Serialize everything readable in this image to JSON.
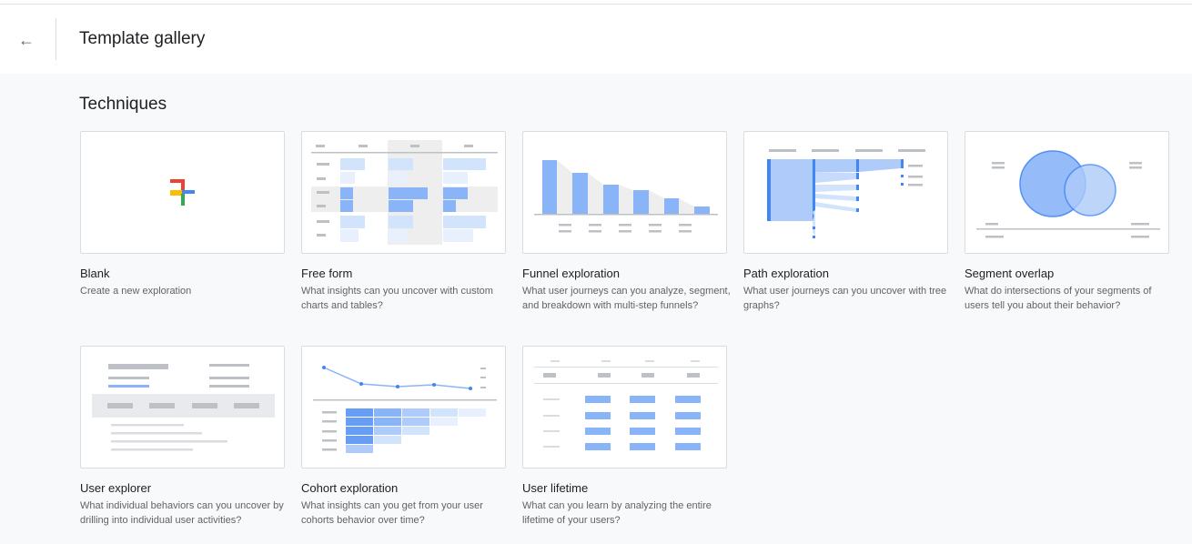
{
  "header": {
    "back_icon": "arrow-left-icon",
    "title": "Template gallery"
  },
  "section_title": "Techniques",
  "cards": [
    {
      "name": "Blank",
      "desc": "Create a new exploration",
      "icon": "plus-icon"
    },
    {
      "name": "Free form",
      "desc": "What insights can you uncover with custom charts and tables?"
    },
    {
      "name": "Funnel exploration",
      "desc": "What user journeys can you analyze, segment, and breakdown with multi-step funnels?"
    },
    {
      "name": "Path exploration",
      "desc": "What user journeys can you uncover with tree graphs?"
    },
    {
      "name": "Segment overlap",
      "desc": "What do intersections of your segments of users tell you about their behavior?"
    },
    {
      "name": "User explorer",
      "desc": "What individual behaviors can you uncover by drilling into individual user activities?"
    },
    {
      "name": "Cohort exploration",
      "desc": "What insights can you get from your user cohorts behavior over time?"
    },
    {
      "name": "User lifetime",
      "desc": "What can you learn by analyzing the entire lifetime of your users?"
    }
  ],
  "colors": {
    "accent_blue": "#8ab4f8",
    "light_blue": "#d2e3fc",
    "grey": "#dadce0",
    "dark_grey": "#bdc1c6"
  }
}
